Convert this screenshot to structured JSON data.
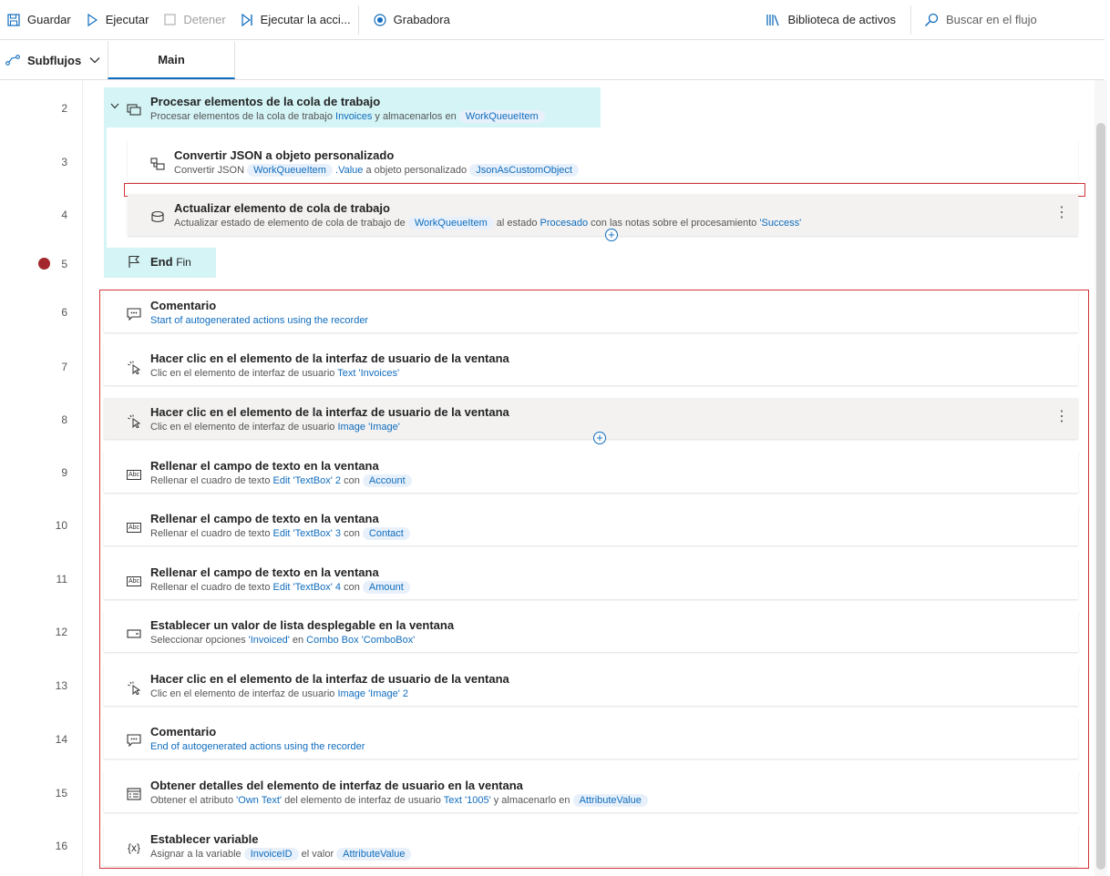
{
  "toolbar": {
    "save": "Guardar",
    "run": "Ejecutar",
    "stop": "Detener",
    "run_action": "Ejecutar la acci...",
    "recorder": "Grabadora",
    "assets": "Biblioteca de activos",
    "search_placeholder": "Buscar en el flujo"
  },
  "tabs": {
    "subflows": "Subflujos",
    "main": "Main"
  },
  "actions": [
    {
      "line": "2",
      "title": "Procesar elementos de la cola de trabajo",
      "sub": [
        {
          "t": "Procesar elementos de la cola de trabajo "
        },
        {
          "t": "Invoices",
          "k": "blue"
        },
        {
          "t": " y almacenarlos en "
        },
        {
          "t": "WorkQueueItem",
          "k": "pill"
        }
      ]
    },
    {
      "line": "3",
      "title": "Convertir JSON a objeto personalizado",
      "sub": [
        {
          "t": "Convertir JSON "
        },
        {
          "t": "WorkQueueItem",
          "k": "pill"
        },
        {
          "t": " .Value",
          "k": "blue"
        },
        {
          "t": " a objeto personalizado "
        },
        {
          "t": "JsonAsCustomObject",
          "k": "pill"
        }
      ]
    },
    {
      "line": "4",
      "title": "Actualizar elemento de cola de trabajo",
      "sub": [
        {
          "t": "Actualizar estado de elemento de cola de trabajo de "
        },
        {
          "t": "WorkQueueItem",
          "k": "pill"
        },
        {
          "t": " al estado "
        },
        {
          "t": "Procesado",
          "k": "blue"
        },
        {
          "t": " con las notas sobre el procesamiento "
        },
        {
          "t": "'Success'",
          "k": "blue"
        }
      ]
    },
    {
      "line": "5",
      "title": "End",
      "sub_text": "Fin"
    },
    {
      "line": "6",
      "title": "Comentario",
      "sub": [
        {
          "t": "Start of autogenerated actions using the recorder",
          "k": "blue"
        }
      ]
    },
    {
      "line": "7",
      "title": "Hacer clic en el elemento de la interfaz de usuario de la ventana",
      "sub": [
        {
          "t": "Clic en el elemento de interfaz de usuario "
        },
        {
          "t": "Text 'Invoices'",
          "k": "blue"
        }
      ]
    },
    {
      "line": "8",
      "title": "Hacer clic en el elemento de la interfaz de usuario de la ventana",
      "sub": [
        {
          "t": "Clic en el elemento de interfaz de usuario "
        },
        {
          "t": "Image 'Image'",
          "k": "blue"
        }
      ]
    },
    {
      "line": "9",
      "title": "Rellenar el campo de texto en la ventana",
      "sub": [
        {
          "t": "Rellenar el cuadro de texto "
        },
        {
          "t": "Edit 'TextBox' 2",
          "k": "blue"
        },
        {
          "t": " con "
        },
        {
          "t": "Account",
          "k": "pill"
        }
      ]
    },
    {
      "line": "10",
      "title": "Rellenar el campo de texto en la ventana",
      "sub": [
        {
          "t": "Rellenar el cuadro de texto "
        },
        {
          "t": "Edit 'TextBox' 3",
          "k": "blue"
        },
        {
          "t": " con "
        },
        {
          "t": "Contact",
          "k": "pill"
        }
      ]
    },
    {
      "line": "11",
      "title": "Rellenar el campo de texto en la ventana",
      "sub": [
        {
          "t": "Rellenar el cuadro de texto "
        },
        {
          "t": "Edit 'TextBox' 4",
          "k": "blue"
        },
        {
          "t": " con "
        },
        {
          "t": "Amount",
          "k": "pill"
        }
      ]
    },
    {
      "line": "12",
      "title": "Establecer un valor de lista desplegable en la ventana",
      "sub": [
        {
          "t": "Seleccionar opciones "
        },
        {
          "t": "'Invoiced'",
          "k": "blue"
        },
        {
          "t": " en "
        },
        {
          "t": "Combo Box 'ComboBox'",
          "k": "blue"
        }
      ]
    },
    {
      "line": "13",
      "title": "Hacer clic en el elemento de la interfaz de usuario de la ventana",
      "sub": [
        {
          "t": "Clic en el elemento de interfaz de usuario "
        },
        {
          "t": "Image 'Image' 2",
          "k": "blue"
        }
      ]
    },
    {
      "line": "14",
      "title": "Comentario",
      "sub": [
        {
          "t": "End of autogenerated actions using the recorder",
          "k": "blue"
        }
      ]
    },
    {
      "line": "15",
      "title": "Obtener detalles del elemento de interfaz de usuario en la ventana",
      "sub": [
        {
          "t": "Obtener el atributo "
        },
        {
          "t": "'Own Text'",
          "k": "blue"
        },
        {
          "t": " del elemento de interfaz de usuario "
        },
        {
          "t": "Text '1005'",
          "k": "blue"
        },
        {
          "t": " y almacenarlo en "
        },
        {
          "t": "AttributeValue",
          "k": "pill"
        }
      ]
    },
    {
      "line": "16",
      "title": "Establecer variable",
      "sub": [
        {
          "t": "Asignar a la variable "
        },
        {
          "t": "InvoiceID",
          "k": "pill"
        },
        {
          "t": " el valor "
        },
        {
          "t": "AttributeValue",
          "k": "pill"
        }
      ]
    }
  ],
  "colors": {
    "accent": "#0f6cbd",
    "loop_bg": "#d4f4f6",
    "highlight_border": "#d13438",
    "breakpoint": "#a4262c"
  }
}
